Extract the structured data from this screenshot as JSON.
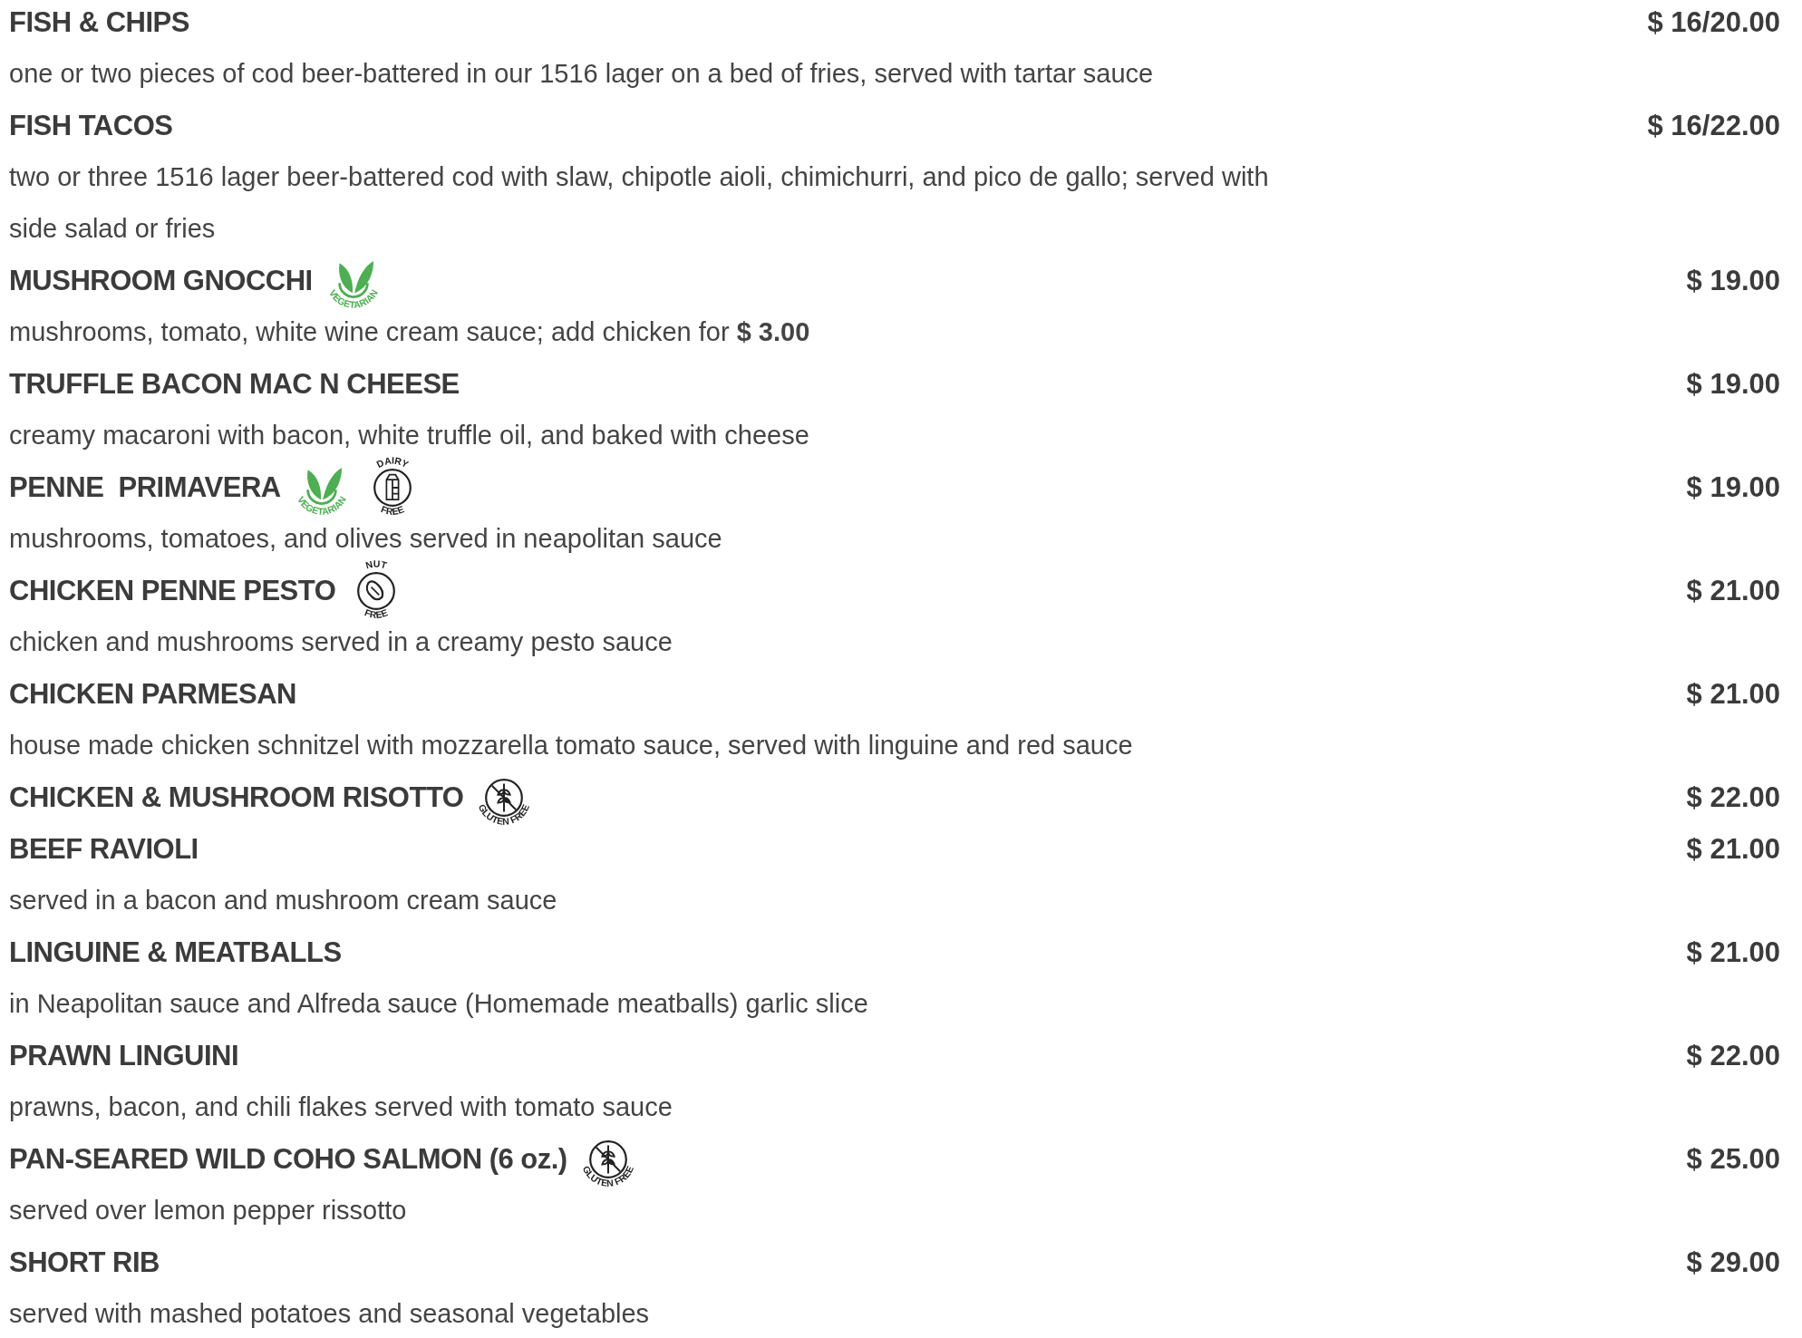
{
  "items": [
    {
      "name": "FISH & CHIPS",
      "price": "$ 16/20.00",
      "description": "one or two pieces of cod beer-battered in our 1516 lager on a bed of fries, served with tartar sauce"
    },
    {
      "name": "FISH TACOS",
      "price": "$ 16/22.00",
      "description": "two or three 1516 lager beer-battered cod with slaw, chipotle aioli, chimichurri, and pico de gallo; served with side salad or fries"
    },
    {
      "name": "MUSHROOM GNOCCHI",
      "price": "$ 19.00",
      "description": "mushrooms, tomato, white wine cream sauce; add chicken for **$ 3.00**",
      "badges": [
        {
          "kind": "vegetarian",
          "label": "VEGETARIAN"
        }
      ]
    },
    {
      "name": "TRUFFLE BACON MAC N CHEESE",
      "price": "$ 19.00",
      "description": "creamy macaroni with bacon, white truffle oil, and baked with cheese"
    },
    {
      "name": "PENNE  PRIMAVERA",
      "price": "$ 19.00",
      "description": "mushrooms, tomatoes, and olives served in neapolitan sauce",
      "badges": [
        {
          "kind": "vegetarian",
          "label": "VEGETARIAN"
        },
        {
          "kind": "dairy_free",
          "label_top": "DAIRY",
          "label_bottom": "FREE"
        }
      ]
    },
    {
      "name": "CHICKEN PENNE PESTO",
      "price": "$ 21.00",
      "description": "chicken and mushrooms served in a creamy pesto sauce",
      "badges": [
        {
          "kind": "nut_free",
          "label_top": "NUT",
          "label_bottom": "FREE"
        }
      ]
    },
    {
      "name": "CHICKEN PARMESAN",
      "price": "$ 21.00",
      "description": "house made chicken schnitzel with mozzarella tomato sauce, served with linguine and red sauce"
    },
    {
      "name": "CHICKEN & MUSHROOM RISOTTO",
      "price": "$ 22.00",
      "badges": [
        {
          "kind": "gluten_free",
          "label": "GLUTEN FREE"
        }
      ]
    },
    {
      "name": "BEEF RAVIOLI",
      "price": "$ 21.00",
      "description": "served in a bacon and mushroom cream sauce"
    },
    {
      "name": "LINGUINE & MEATBALLS",
      "price": "$ 21.00",
      "description": "in Neapolitan sauce and Alfreda sauce (Homemade meatballs) garlic slice"
    },
    {
      "name": "PRAWN LINGUINI",
      "price": "$ 22.00",
      "description": "prawns, bacon, and chili flakes served with tomato sauce"
    },
    {
      "name": "PAN-SEARED WILD COHO SALMON (6 oz.)",
      "price": "$ 25.00",
      "description": "served over lemon pepper rissotto",
      "badges": [
        {
          "kind": "gluten_free",
          "label": "GLUTEN FREE"
        }
      ]
    },
    {
      "name": "SHORT RIB",
      "price": "$ 29.00",
      "description": "served with mashed potatoes and seasonal vegetables"
    }
  ]
}
